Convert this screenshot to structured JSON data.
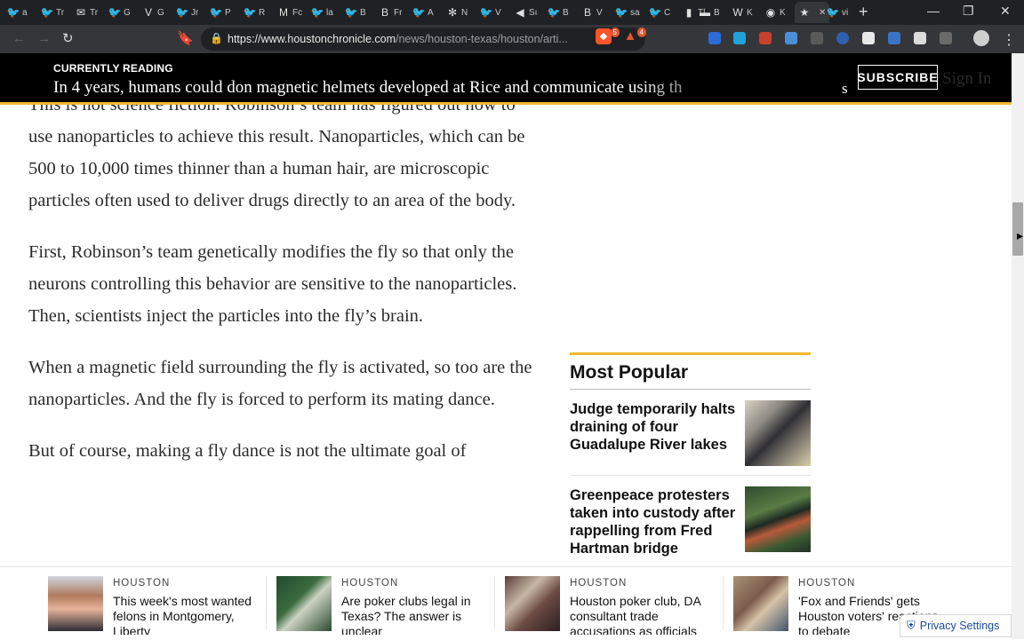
{
  "browser": {
    "tabs": [
      {
        "label": "a",
        "icon": "twitter-icon",
        "glyph": "🐦"
      },
      {
        "label": "Tr",
        "icon": "twitter-icon",
        "glyph": "🐦"
      },
      {
        "label": "Tr",
        "icon": "gmail-icon",
        "glyph": "✉"
      },
      {
        "label": "G",
        "icon": "twitter-icon",
        "glyph": "🐦"
      },
      {
        "label": "G",
        "icon": "vote-icon",
        "glyph": "V"
      },
      {
        "label": "Jr",
        "icon": "twitter-icon",
        "glyph": "🐦"
      },
      {
        "label": "P",
        "icon": "twitter-icon",
        "glyph": "🐦"
      },
      {
        "label": "R",
        "icon": "twitter-icon",
        "glyph": "🐦"
      },
      {
        "label": "Fc",
        "icon": "medium-icon",
        "glyph": "M"
      },
      {
        "label": "la",
        "icon": "twitter-icon",
        "glyph": "🐦"
      },
      {
        "label": "B",
        "icon": "twitter-icon",
        "glyph": "🐦"
      },
      {
        "label": "Fr",
        "icon": "brave-icon",
        "glyph": "B"
      },
      {
        "label": "A",
        "icon": "twitter-icon",
        "glyph": "🐦"
      },
      {
        "label": "N",
        "icon": "gear-icon",
        "glyph": "✻"
      },
      {
        "label": "V",
        "icon": "twitter-icon",
        "glyph": "🐦"
      },
      {
        "label": "Sı",
        "icon": "arrow-icon",
        "glyph": "◀"
      },
      {
        "label": "B",
        "icon": "twitter-icon",
        "glyph": "🐦"
      },
      {
        "label": "V",
        "icon": "brave-icon",
        "glyph": "B"
      },
      {
        "label": "sa",
        "icon": "twitter-icon",
        "glyph": "🐦"
      },
      {
        "label": "C",
        "icon": "twitter-icon",
        "glyph": "🐦"
      },
      {
        "label": "Tl",
        "icon": "page-icon",
        "glyph": "▮"
      },
      {
        "label": "B",
        "icon": "flag-icon",
        "glyph": "▬"
      },
      {
        "label": "K",
        "icon": "wikipedia-icon",
        "glyph": "W"
      },
      {
        "label": "K",
        "icon": "globe-icon",
        "glyph": "◉"
      },
      {
        "label": "",
        "icon": "star-icon",
        "glyph": "★"
      },
      {
        "label": "vi",
        "icon": "twitter-icon",
        "glyph": "🐦"
      }
    ],
    "new_tab": "+",
    "window": {
      "minimize": "—",
      "restore": "❐",
      "close": "✕"
    },
    "nav": {
      "back": "←",
      "forward": "→",
      "reload": "↻",
      "bookmark": "🔖"
    },
    "url_host": "https://www.houstonchronicle.com",
    "url_path": "/news/houston-texas/houston/arti...",
    "shield_badge": "5",
    "rewards_badge": "4",
    "menu": "⋮"
  },
  "readbar": {
    "eyebrow": "CURRENTLY READING",
    "headline": "In 4 years, humans could don magnetic helmets developed at Rice and communicate using th",
    "tail": "s",
    "subscribe": "SUBSCRIBE",
    "signin": "Sign In"
  },
  "article": {
    "paragraphs": [
      "This is not science fiction. Robinson’s team has figured out how to use nanoparticles to achieve this result. Nanoparticles, which can be 500 to 10,000 times thinner than a human hair, are microscopic particles often used to deliver drugs directly to an area of the body.",
      "First, Robinson’s team genetically modifies the fly so that only the neurons controlling this behavior are sensitive to the nanoparticles. Then, scientists inject the particles into the fly’s brain.",
      "When a magnetic field surrounding the fly is activated, so too are the nanoparticles. And the fly is forced to perform its mating dance.",
      "But of course, making a fly dance is not the ultimate goal of"
    ]
  },
  "most_popular": {
    "title": "Most Popular",
    "items": [
      {
        "headline": "Judge temporarily halts draining of four Guadalupe River lakes"
      },
      {
        "headline": "Greenpeace protesters taken into custody after rappelling from Fred Hartman bridge"
      }
    ]
  },
  "rail": {
    "cards": [
      {
        "section": "HOUSTON",
        "headline": "This week's most wanted felons in Montgomery, Liberty"
      },
      {
        "section": "HOUSTON",
        "headline": "Are poker clubs legal in Texas? The answer is unclear"
      },
      {
        "section": "HOUSTON",
        "headline": "Houston poker club, DA consultant trade accusations as officials"
      },
      {
        "section": "HOUSTON",
        "headline": "'Fox and Friends' gets Houston voters' reactions to debate"
      }
    ]
  },
  "privacy": {
    "label": "Privacy Settings"
  },
  "colors": {
    "accent": "#f2b830",
    "header_bg": "#000000",
    "privacy_text": "#1a4aa0"
  }
}
